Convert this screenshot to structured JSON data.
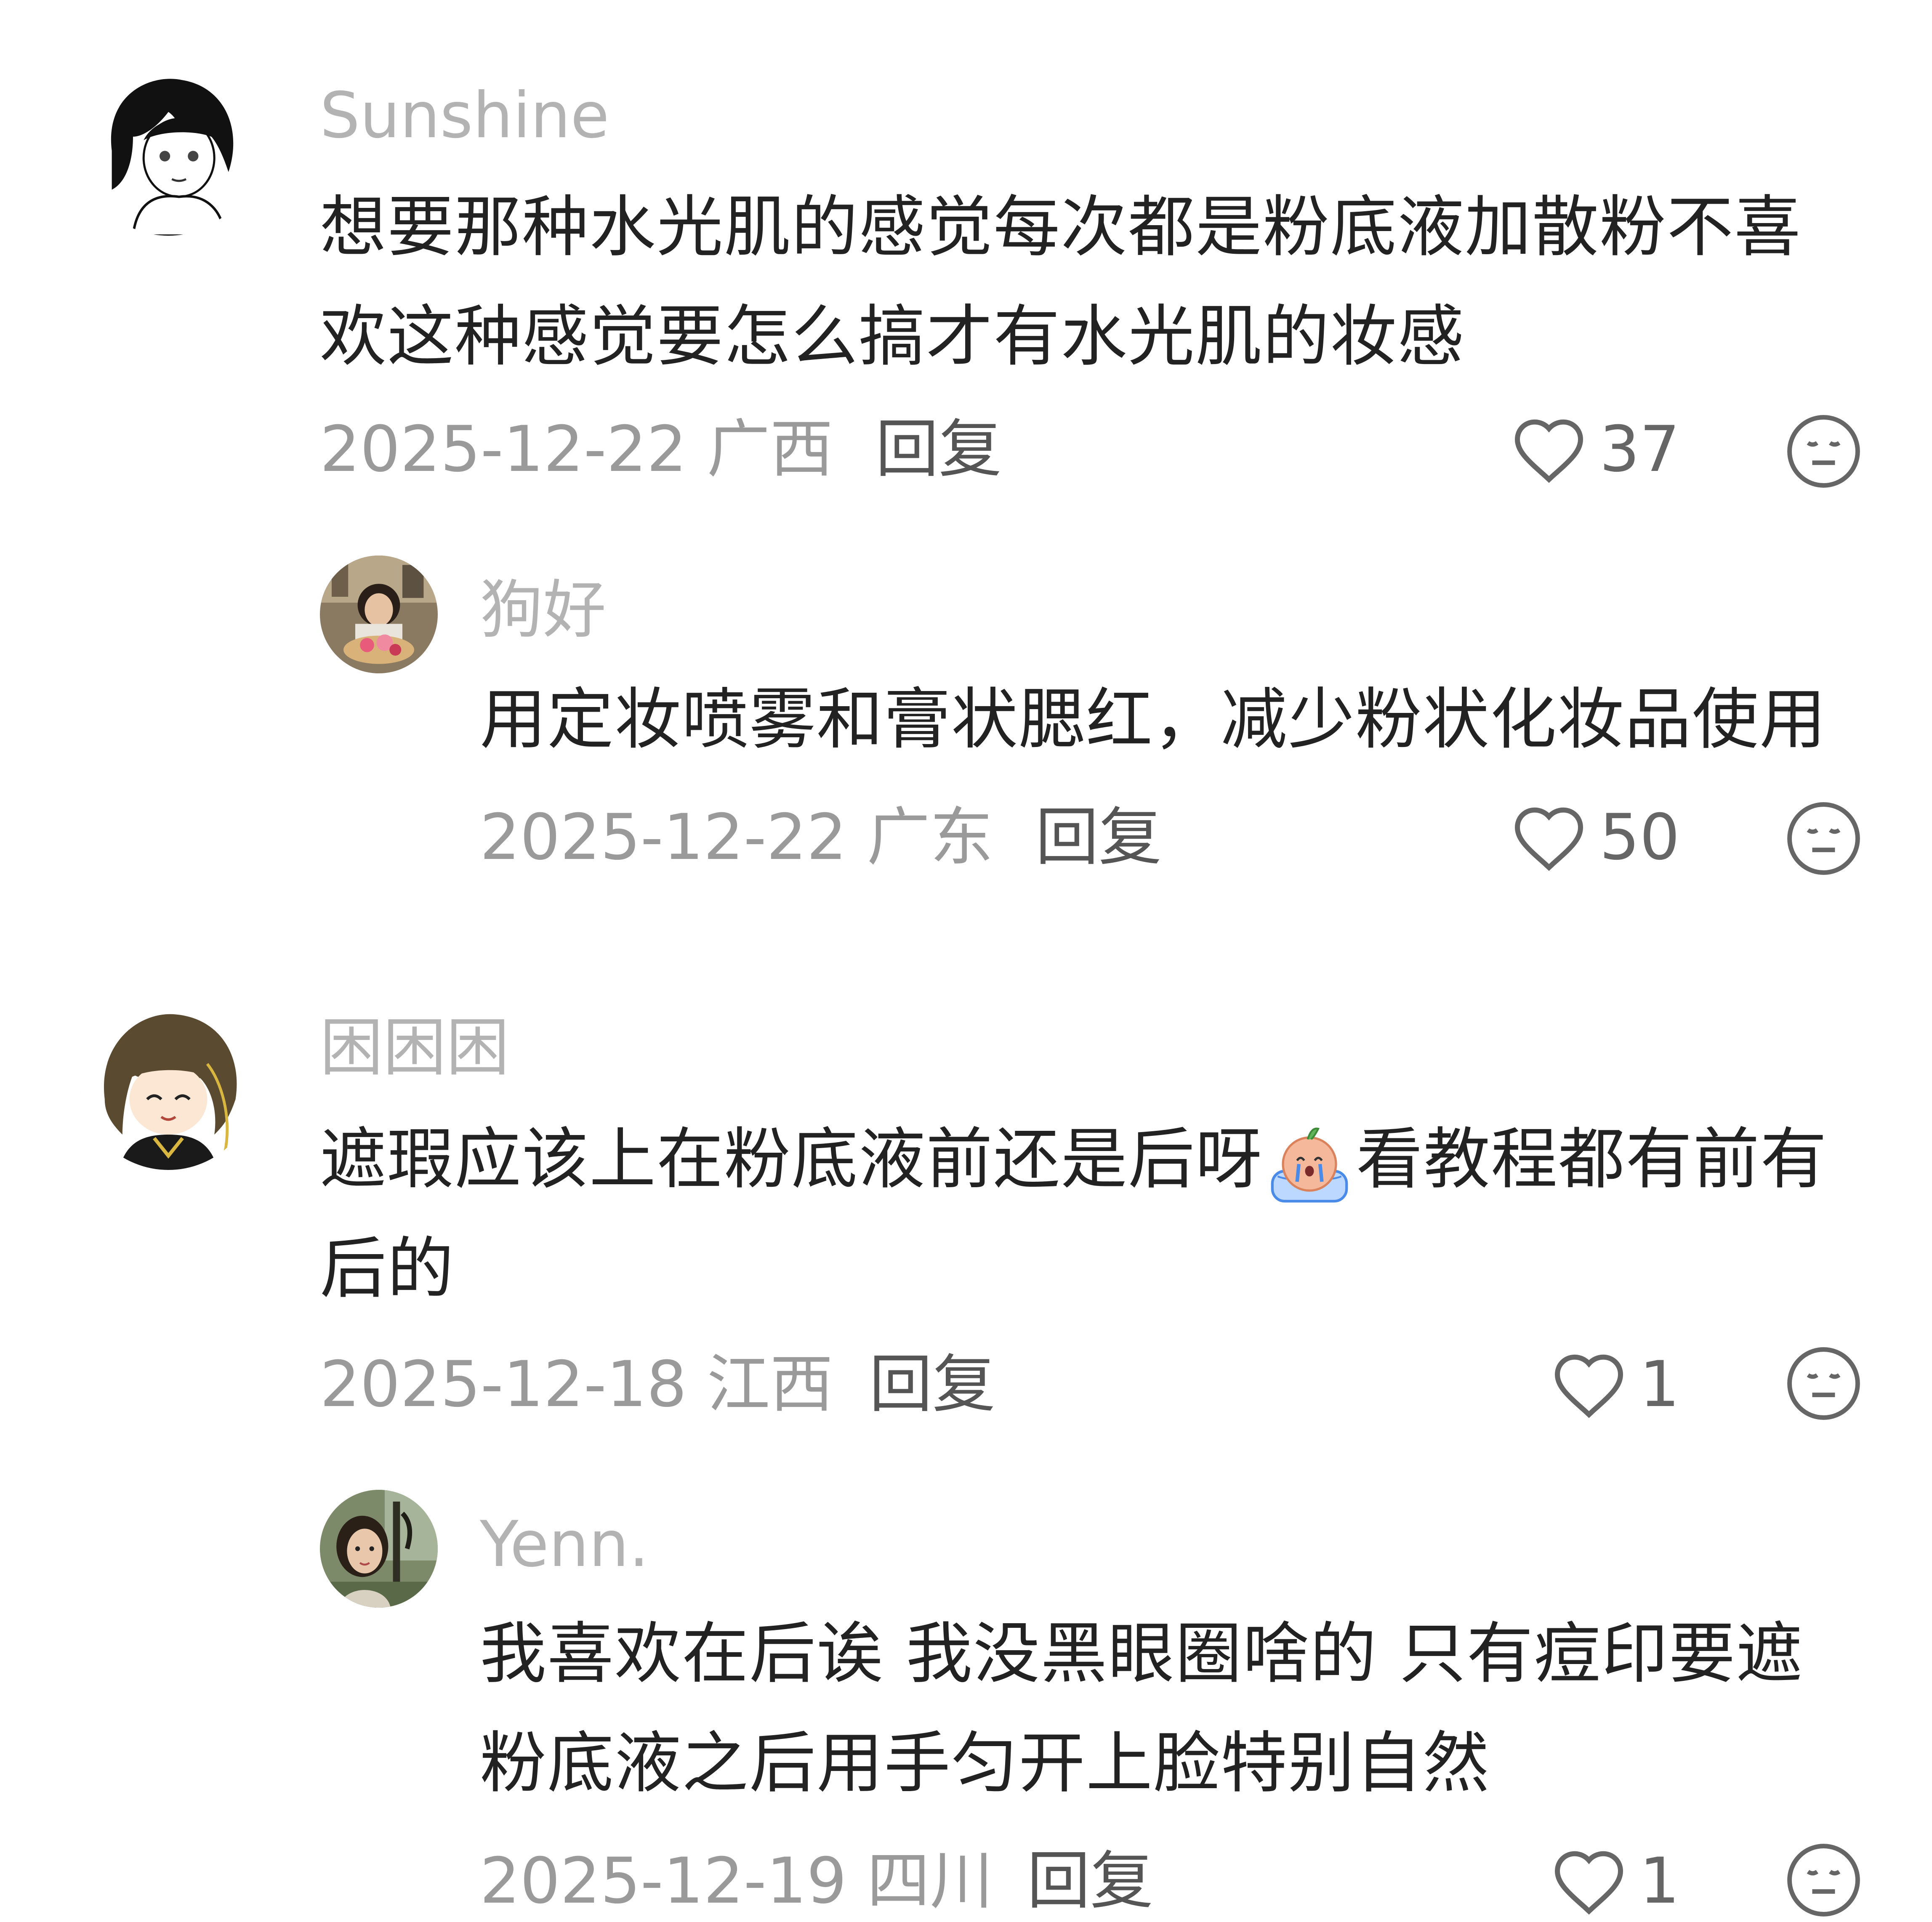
{
  "comments": [
    {
      "username": "Sunshine",
      "text": "想要那种水光肌的感觉每次都是粉底液加散粉不喜欢这种感觉要怎么搞才有水光肌的妆感",
      "date_loc": "2025-12-22 广西",
      "reply_label": "回复",
      "likes": "37",
      "avatar_icon": "anime-avatar-black-hair"
    },
    {
      "username": "狗好",
      "text": "用定妆喷雾和膏状腮红，减少粉状化妆品使用",
      "date_loc": "2025-12-22 广东",
      "reply_label": "回复",
      "likes": "50",
      "avatar_icon": "photo-avatar-girl-cake"
    },
    {
      "username": "困困困",
      "text_before": "遮瑕应该上在粉底液前还是后呀",
      "text_after": "看教程都有前有后的",
      "emoji_icon": "crying-peach-emoji",
      "date_loc": "2025-12-18 江西",
      "reply_label": "回复",
      "likes": "1",
      "avatar_icon": "anime-avatar-brown-hair"
    },
    {
      "username": "Yenn.",
      "text": "我喜欢在后诶 我没黑眼圈啥的 只有痘印要遮粉底液之后用手匀开上脸特别自然",
      "date_loc": "2025-12-19 四川",
      "reply_label": "回复",
      "likes": "1",
      "avatar_icon": "photo-avatar-outdoor"
    }
  ],
  "colors": {
    "username": "#b3b3b3",
    "text": "#222222",
    "meta": "#9a9a9a",
    "reply": "#555555",
    "icon": "#666666"
  },
  "icons": {
    "like": "heart-outline-icon",
    "dislike": "neutral-face-icon"
  }
}
